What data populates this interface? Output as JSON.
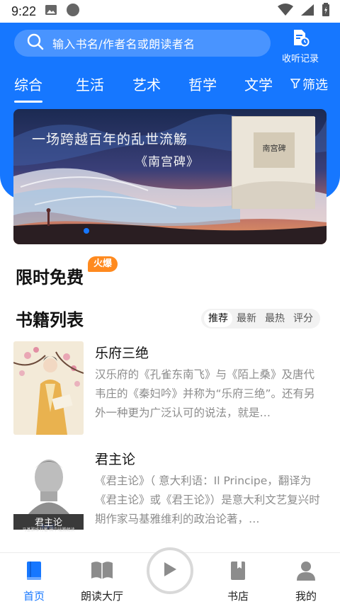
{
  "status_bar": {
    "time": "9:22"
  },
  "search": {
    "placeholder": "输入书名/作者名或朗读者名"
  },
  "history": {
    "label": "收听记录"
  },
  "tabs": [
    {
      "label": "综合"
    },
    {
      "label": "生活"
    },
    {
      "label": "艺术"
    },
    {
      "label": "哲学"
    },
    {
      "label": "文学"
    }
  ],
  "filter": {
    "label": "筛选"
  },
  "banner": {
    "line1": "一场跨越百年的乱世流觞",
    "line2": "《南宫碑》",
    "book_title": "南宫碑"
  },
  "free_section": {
    "title": "限时免费",
    "badge": "火爆"
  },
  "books_section": {
    "title": "书籍列表",
    "sort_options": [
      "推荐",
      "最新",
      "最热",
      "评分"
    ]
  },
  "books": [
    {
      "name": "乐府三绝",
      "description": "汉乐府的《孔雀东南飞》与《陌上桑》及唐代韦庄的《秦妇吟》并称为“乐府三绝”。还有另外一种更为广泛认可的说法，就是…"
    },
    {
      "name": "君主论",
      "description": "《君主论》（ 意大利语：Il Principe，翻译为《君主论》或《君王论》）是意大利文艺复兴时期作家马基雅维利的政治论著，…",
      "cover_title": "君主论",
      "cover_subtitle": "马基雅维利著 田中瑞腾朗读"
    }
  ],
  "bottom_nav": {
    "home": "首页",
    "reading_hall": "朗读大厅",
    "bookstore": "书店",
    "mine": "我的"
  },
  "colors": {
    "primary": "#1677ff",
    "badge": "#ff8a1f"
  }
}
